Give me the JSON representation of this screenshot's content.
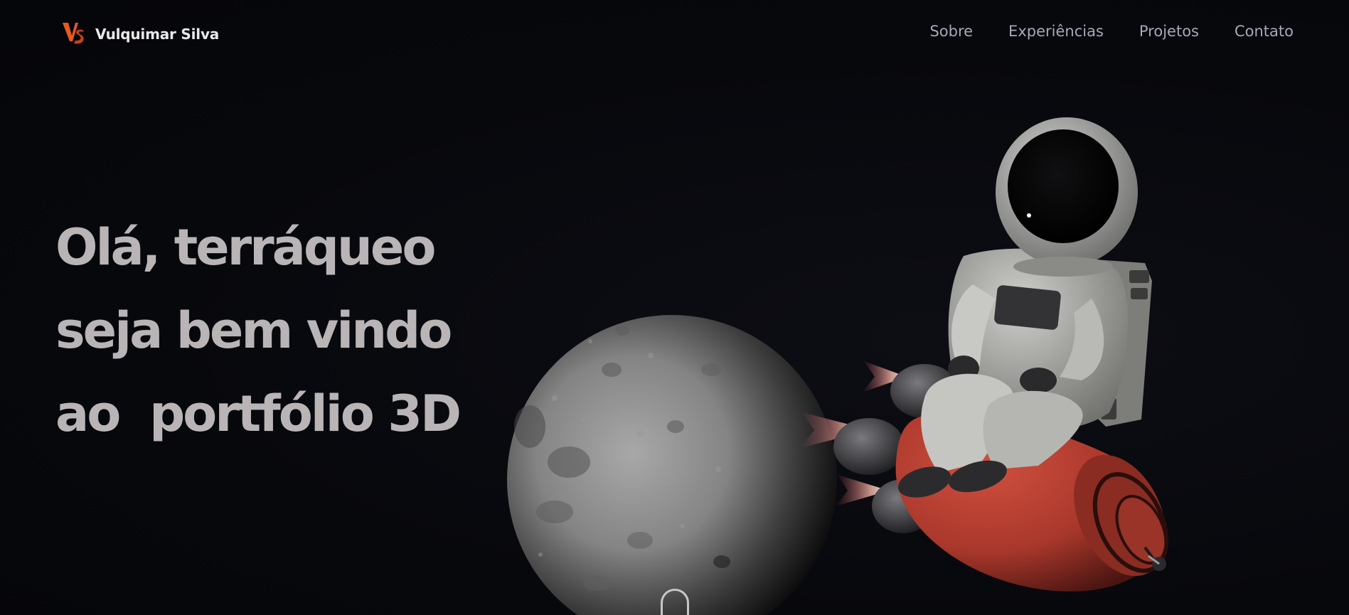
{
  "navbar": {
    "brand_name": "Vulquimar Silva",
    "logo_icon": "vs-monogram-logo",
    "links": [
      {
        "label": "Sobre"
      },
      {
        "label": "Experiências"
      },
      {
        "label": "Projetos"
      },
      {
        "label": "Contato"
      }
    ]
  },
  "hero": {
    "lines": [
      "Olá, terráqueo",
      "seja bem vindo",
      "ao  portfólio 3D"
    ]
  },
  "scene": {
    "moon_icon": "moon-illustration",
    "astronaut_icon": "astronaut-on-rocket-illustration",
    "scroll_icon": "scroll-down-indicator-icon"
  },
  "colors": {
    "background": "#07080c",
    "brand_text": "#e9e9ea",
    "nav_text": "#a9a7b6",
    "hero_text": "#b9b5b6",
    "logo_accent": "#e85a1e",
    "rocket": "#b8392d"
  }
}
